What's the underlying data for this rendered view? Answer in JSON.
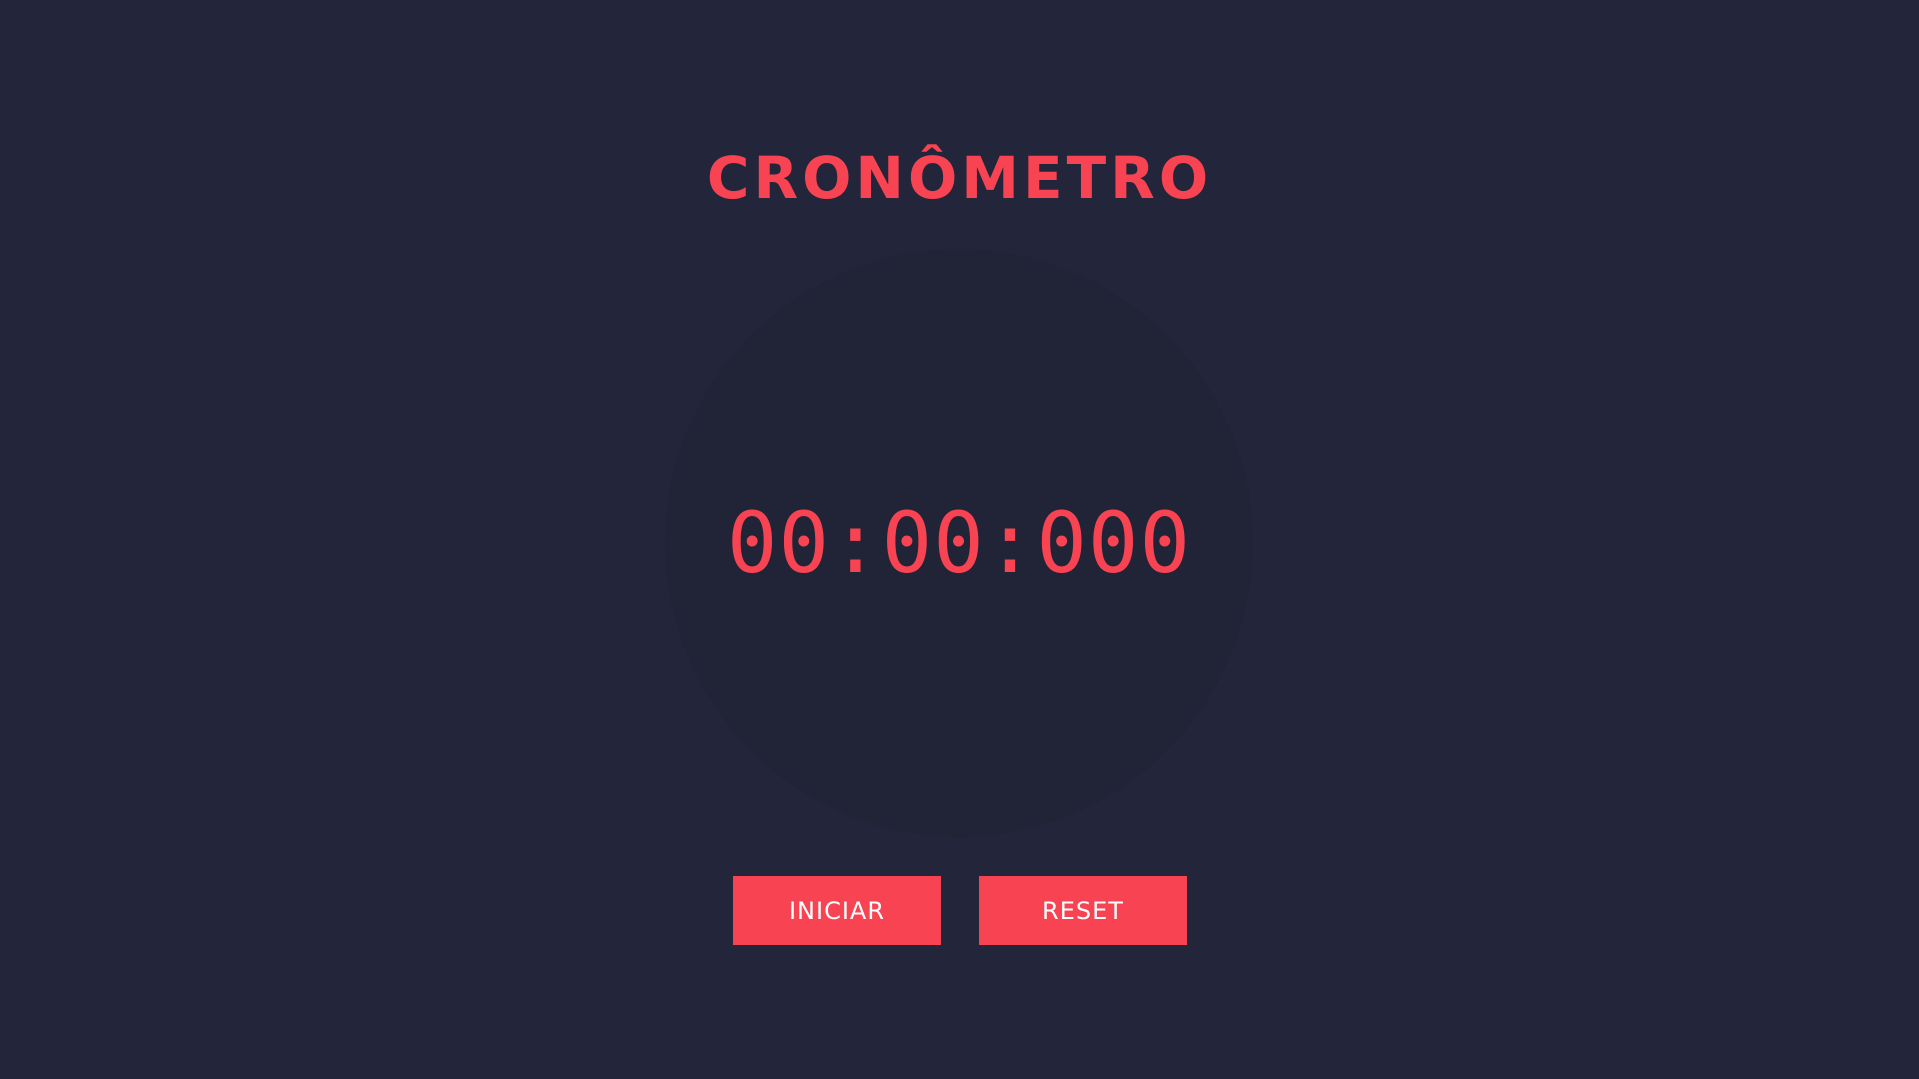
{
  "header": {
    "title": "CRONÔMETRO"
  },
  "stopwatch": {
    "display": "00:00:000"
  },
  "controls": {
    "start_label": "INICIAR",
    "reset_label": "RESET"
  },
  "colors": {
    "background": "#23253a",
    "dial": "#212336",
    "accent": "#f84452",
    "button_text": "#ffffff"
  }
}
